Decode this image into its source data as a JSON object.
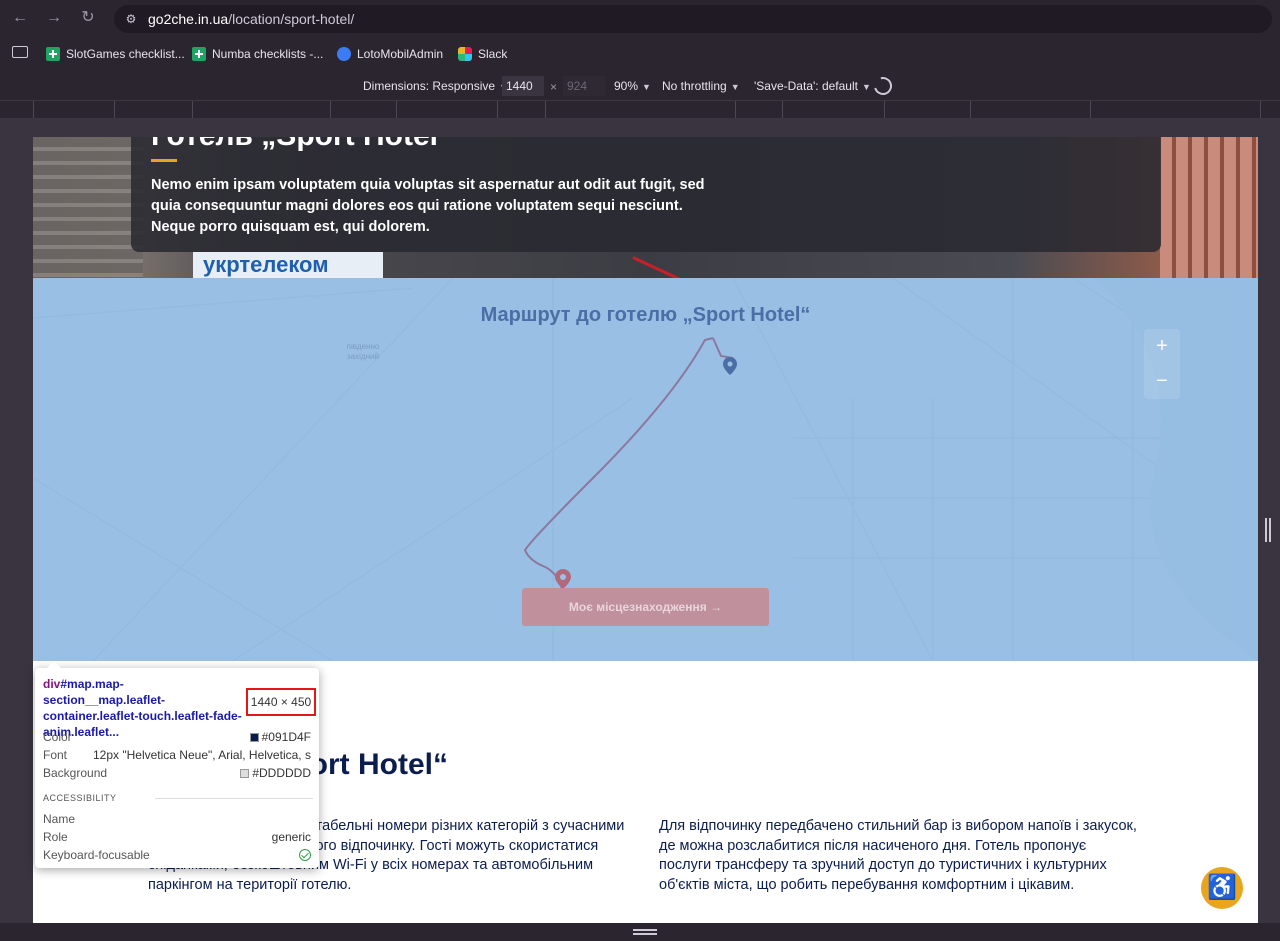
{
  "browser": {
    "url_host": "go2che.in.ua",
    "url_path": "/location/sport-hotel/",
    "back_icon": "back-arrow-icon",
    "forward_icon": "forward-arrow-icon",
    "reload_icon": "reload-icon"
  },
  "bookmarks": [
    {
      "label": "SlotGames checklist...",
      "icon": "sheets-icon"
    },
    {
      "label": "Numba checklists -...",
      "icon": "sheets-icon"
    },
    {
      "label": "LotoMobilAdmin",
      "icon": "loto-icon"
    },
    {
      "label": "Slack",
      "icon": "slack-icon"
    }
  ],
  "device_toolbar": {
    "dimensions_label": "Dimensions: Responsive",
    "width": "1440",
    "times": "×",
    "height": "924",
    "zoom": "90%",
    "throttling": "No throttling",
    "save_data": "'Save-Data': default"
  },
  "hero": {
    "title": "Готель „Sport Hotel“",
    "text": "Nemo enim ipsam voluptatem quia voluptas sit aspernatur aut odit aut fugit, sed quia consequuntur magni dolores eos qui ratione voluptatem sequi nesciunt. Neque porro quisquam est, qui dolorem.",
    "sign_text": "укртелеком"
  },
  "map": {
    "title": "Маршрут до готелю „Sport Hotel“",
    "district_label": "південно західний",
    "zoom_in": "+",
    "zoom_out": "−",
    "location_button": "Моє місцезнаходження",
    "accent": "#6fa8dc"
  },
  "content": {
    "title": "Готель „Sport Hotel“",
    "left_text": "Готель пропонує комфортабельні номери різних категорій з сучасними зручностями для приємного відпочинку. Гості можуть скористатися сніданками, безкоштовним Wi-Fi у всіх номерах та автомобільним паркінгом на території готелю.",
    "right_text": "Для відпочинку передбачено стильний бар із вибором напоїв і закусок, де можна розслабитися після насиченого дня. Готель пропонує послуги трансферу та зручний доступ до туристичних і культурних об'єктів міста, що робить перебування комфортним і цікавим."
  },
  "inspector": {
    "tag": "div",
    "selector": "#map.map-section__map.leaflet-container.leaflet-touch.leaflet-fade-anim.leaflet...",
    "size": "1440 × 450",
    "color_label": "Color",
    "color_value": "#091D4F",
    "font_label": "Font",
    "font_value": "12px \"Helvetica Neue\", Arial, Helvetica, s...",
    "background_label": "Background",
    "background_value": "#DDDDDD",
    "accessibility_header": "ACCESSIBILITY",
    "name_label": "Name",
    "name_value": "",
    "role_label": "Role",
    "role_value": "generic",
    "focusable_label": "Keyboard-focusable"
  },
  "colors": {
    "accent_gold": "#e8a520",
    "heading_navy": "#0b1d4f",
    "route_red": "#c02030"
  }
}
